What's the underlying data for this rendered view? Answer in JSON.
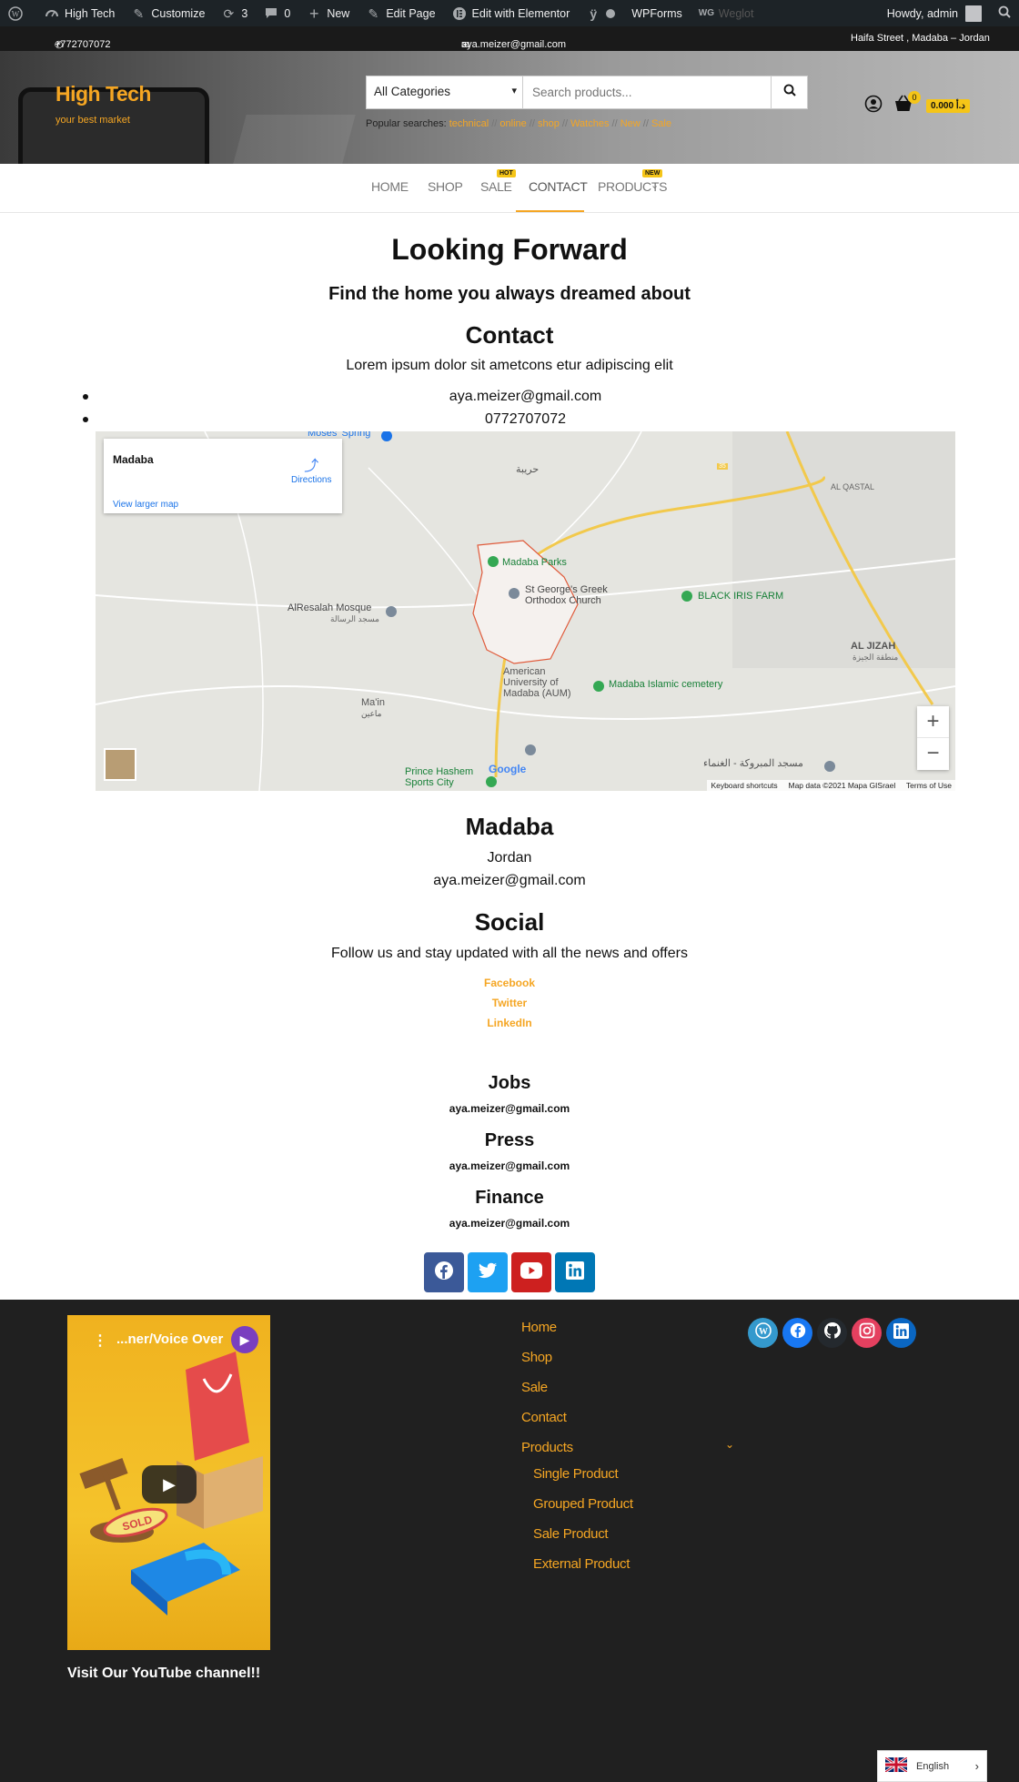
{
  "admin_bar": {
    "site_name": "High Tech",
    "customize": "Customize",
    "updates_count": "3",
    "comments_count": "0",
    "new": "New",
    "edit_page": "Edit Page",
    "edit_elementor": "Edit with Elementor",
    "wpforms": "WPForms",
    "weglot": "Weglot",
    "howdy": "Howdy, admin"
  },
  "topbar": {
    "phone": "+772707072",
    "email": "aya.meizer@gmail.com",
    "address": "Haifa Street , Madaba – Jordan"
  },
  "header": {
    "logo": "High Tech",
    "tagline": "your best market",
    "category_select": "All Categories",
    "search_placeholder": "Search products...",
    "popular_label": "Popular searches:",
    "popular_tags": [
      "technical",
      "online",
      "shop",
      "Watches",
      "New",
      "Sale"
    ],
    "cart_count": "0",
    "cart_total": "0.000 د.أ"
  },
  "nav": {
    "items": [
      "HOME",
      "SHOP",
      "SALE",
      "CONTACT",
      "PRODUCTS"
    ],
    "sale_badge": "HOT",
    "products_badge": "NEW"
  },
  "content": {
    "heading": "Looking Forward",
    "subheading": "Find the home you always dreamed about",
    "contact_title": "Contact",
    "contact_text": "Lorem ipsum dolor sit ametcons etur adipiscing elit",
    "contact_list": [
      "aya.meizer@gmail.com",
      "0772707072"
    ],
    "city": "Madaba",
    "country": "Jordan",
    "city_email": "aya.meizer@gmail.com",
    "social_title": "Social",
    "social_text": "Follow us and stay updated with all the news and offers",
    "social_links": [
      "Facebook",
      "Twitter",
      "LinkedIn"
    ],
    "jobs_title": "Jobs",
    "jobs_email": "aya.meizer@gmail.com",
    "press_title": "Press",
    "press_email": "aya.meizer@gmail.com",
    "finance_title": "Finance",
    "finance_email": "aya.meizer@gmail.com"
  },
  "map": {
    "place": "Madaba",
    "directions": "Directions",
    "view_larger": "View larger map",
    "labels": {
      "moses_spring": "Moses' Spring",
      "hariya": "حريبة",
      "al_qastal": "AL QASTAL",
      "madaba_parks": "Madaba Parks",
      "st_george": "St George's Greek Orthodox Church",
      "black_iris": "BLACK IRIS FARM",
      "alresalah": "AlResalah Mosque",
      "alresalah_ar": "مسجد الرسالة",
      "al_jizah": "AL JIZAH",
      "al_jizah_ar": "منطقة الجيزة",
      "aum": "American University of Madaba (AUM)",
      "islamic_cemetery": "Madaba Islamic cemetery",
      "main": "Ma'in",
      "main_ar": "ماعين",
      "prince_hashem": "Prince Hashem Sports City",
      "mosque_ar": "مسجد المبروكة - الغنماء",
      "google": "Google",
      "route_35": "35"
    },
    "credits": [
      "Keyboard shortcuts",
      "Map data ©2021 Mapa GISrael",
      "Terms of Use"
    ]
  },
  "footer": {
    "video_title": "...ner/Voice Over",
    "youtube_caption": "Visit Our YouTube channel!!",
    "menu": [
      "Home",
      "Shop",
      "Sale",
      "Contact",
      "Products"
    ],
    "submenu": [
      "Single Product",
      "Grouped Product",
      "Sale Product",
      "External Product"
    ]
  },
  "language": {
    "current": "English"
  },
  "colors": {
    "accent": "#f5a623",
    "badge": "#f5c518",
    "facebook": "#3b5998",
    "twitter": "#1da1f2",
    "youtube": "#cd201f",
    "linkedin": "#0077b5",
    "instagram": "#e4405f",
    "footer_bg": "#202020"
  }
}
